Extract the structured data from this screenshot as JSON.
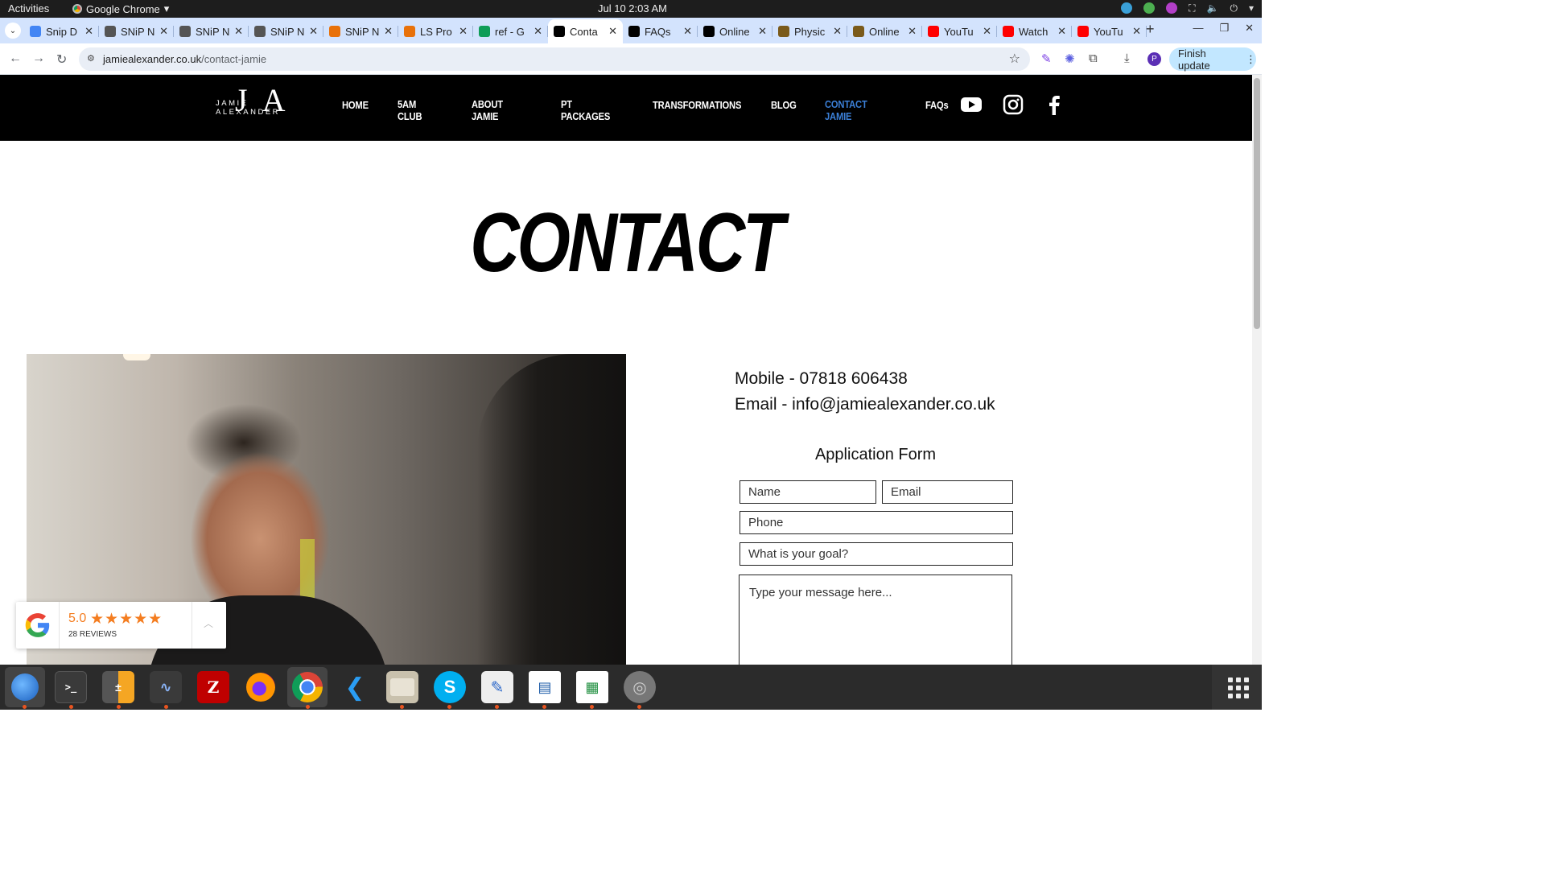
{
  "system": {
    "activities": "Activities",
    "app_name": "Google Chrome",
    "clock": "Jul 10  2:03 AM"
  },
  "tabs": [
    {
      "title": "Snip D",
      "favicon_color": "#4285f4"
    },
    {
      "title": "SNiP N",
      "favicon_color": "#555555"
    },
    {
      "title": "SNiP N",
      "favicon_color": "#555555"
    },
    {
      "title": "SNiP N",
      "favicon_color": "#555555"
    },
    {
      "title": "SNiP N",
      "favicon_color": "#e8710a"
    },
    {
      "title": "LS Pro",
      "favicon_color": "#e8710a"
    },
    {
      "title": "ref - G",
      "favicon_color": "#0f9d58"
    },
    {
      "title": "Conta",
      "favicon_color": "#000000",
      "active": true
    },
    {
      "title": "FAQs",
      "favicon_color": "#000000"
    },
    {
      "title": "Online",
      "favicon_color": "#000000"
    },
    {
      "title": "Physic",
      "favicon_color": "#7a5a1a"
    },
    {
      "title": "Online",
      "favicon_color": "#7a5a1a"
    },
    {
      "title": "YouTu",
      "favicon_color": "#ff0000"
    },
    {
      "title": "Watch",
      "favicon_color": "#ff0000"
    },
    {
      "title": "YouTu",
      "favicon_color": "#ff0000"
    }
  ],
  "address": {
    "domain": "jamiealexander.co.uk",
    "path": "/contact-jamie",
    "finish_update": "Finish update",
    "profile_initial": "P"
  },
  "site": {
    "logo_monogram": "JA",
    "logo_name": "JAMIE ALEXANDER",
    "nav": [
      "HOME",
      "5AM CLUB",
      "ABOUT JAMIE",
      "PT PACKAGES",
      "TRANSFORMATIONS",
      "BLOG",
      "CONTACT JAMIE",
      "FAQs"
    ],
    "active_nav": "CONTACT JAMIE",
    "page_title": "CONTACT",
    "mobile": "Mobile - 07818 606438",
    "email": "Email - info@jamiealexander.co.uk",
    "form_title": "Application Form",
    "form": {
      "name_placeholder": "Name",
      "email_placeholder": "Email",
      "phone_placeholder": "Phone",
      "goal_placeholder": "What is your goal?",
      "message_placeholder": "Type your message here..."
    },
    "reviews": {
      "score": "5.0",
      "stars": "★★★★★",
      "count": "28 REVIEWS"
    }
  },
  "colors": {
    "accent_nav": "#3b7fd6",
    "review_orange": "#f47d20",
    "tabstrip": "#d3e3fd"
  },
  "dock": [
    "thunderbird",
    "terminal",
    "calculator",
    "system-monitor",
    "filezilla",
    "firefox",
    "chrome",
    "vscode",
    "files",
    "skype",
    "text-editor",
    "libreoffice-writer",
    "libreoffice-calc",
    "disk-utility"
  ]
}
